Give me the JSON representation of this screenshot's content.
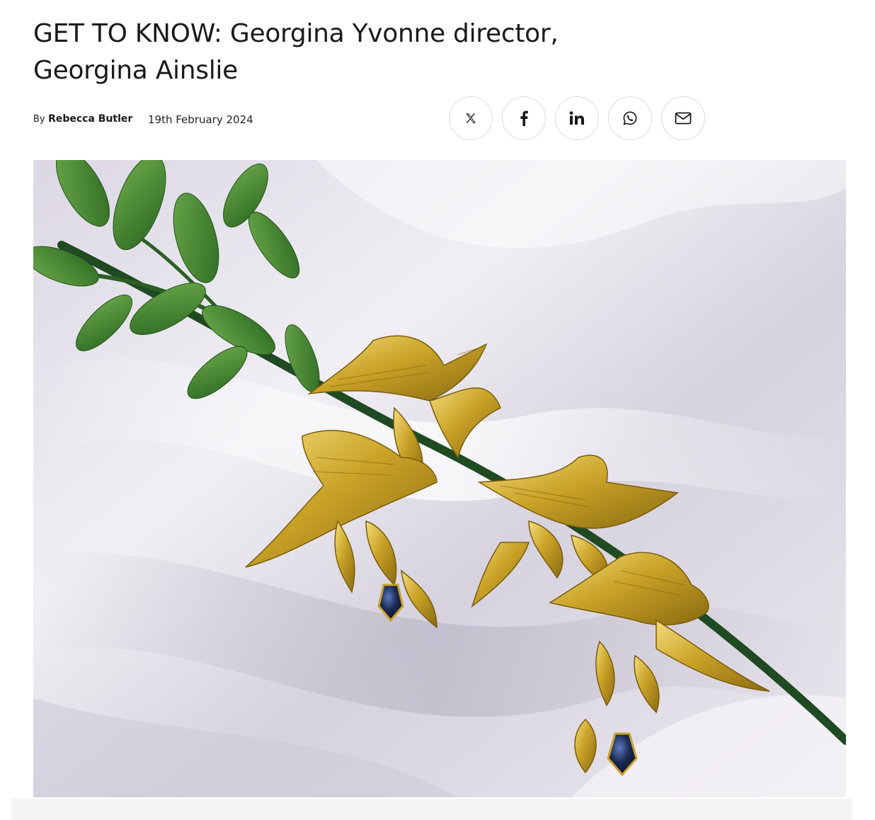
{
  "article": {
    "headline": "GET TO KNOW: Georgina Yvonne director, Georgina Ainslie",
    "byline_prefix": "By",
    "author": "Rebecca Butler",
    "date": "19th February 2024"
  },
  "share": {
    "buttons": [
      {
        "name": "x-share",
        "icon": "x-logo-icon"
      },
      {
        "name": "facebook-share",
        "icon": "facebook-icon"
      },
      {
        "name": "linkedin-share",
        "icon": "linkedin-icon"
      },
      {
        "name": "whatsapp-share",
        "icon": "whatsapp-icon"
      },
      {
        "name": "email-share",
        "icon": "envelope-icon"
      }
    ]
  },
  "hero_image": {
    "subject": "gold-bird-earrings-on-satin",
    "colors": {
      "satin": "#e6e3ec",
      "gold": "#c9a227",
      "leaf": "#3d7a2a",
      "stem": "#1f4a22",
      "gem": "#1b2a55"
    }
  }
}
